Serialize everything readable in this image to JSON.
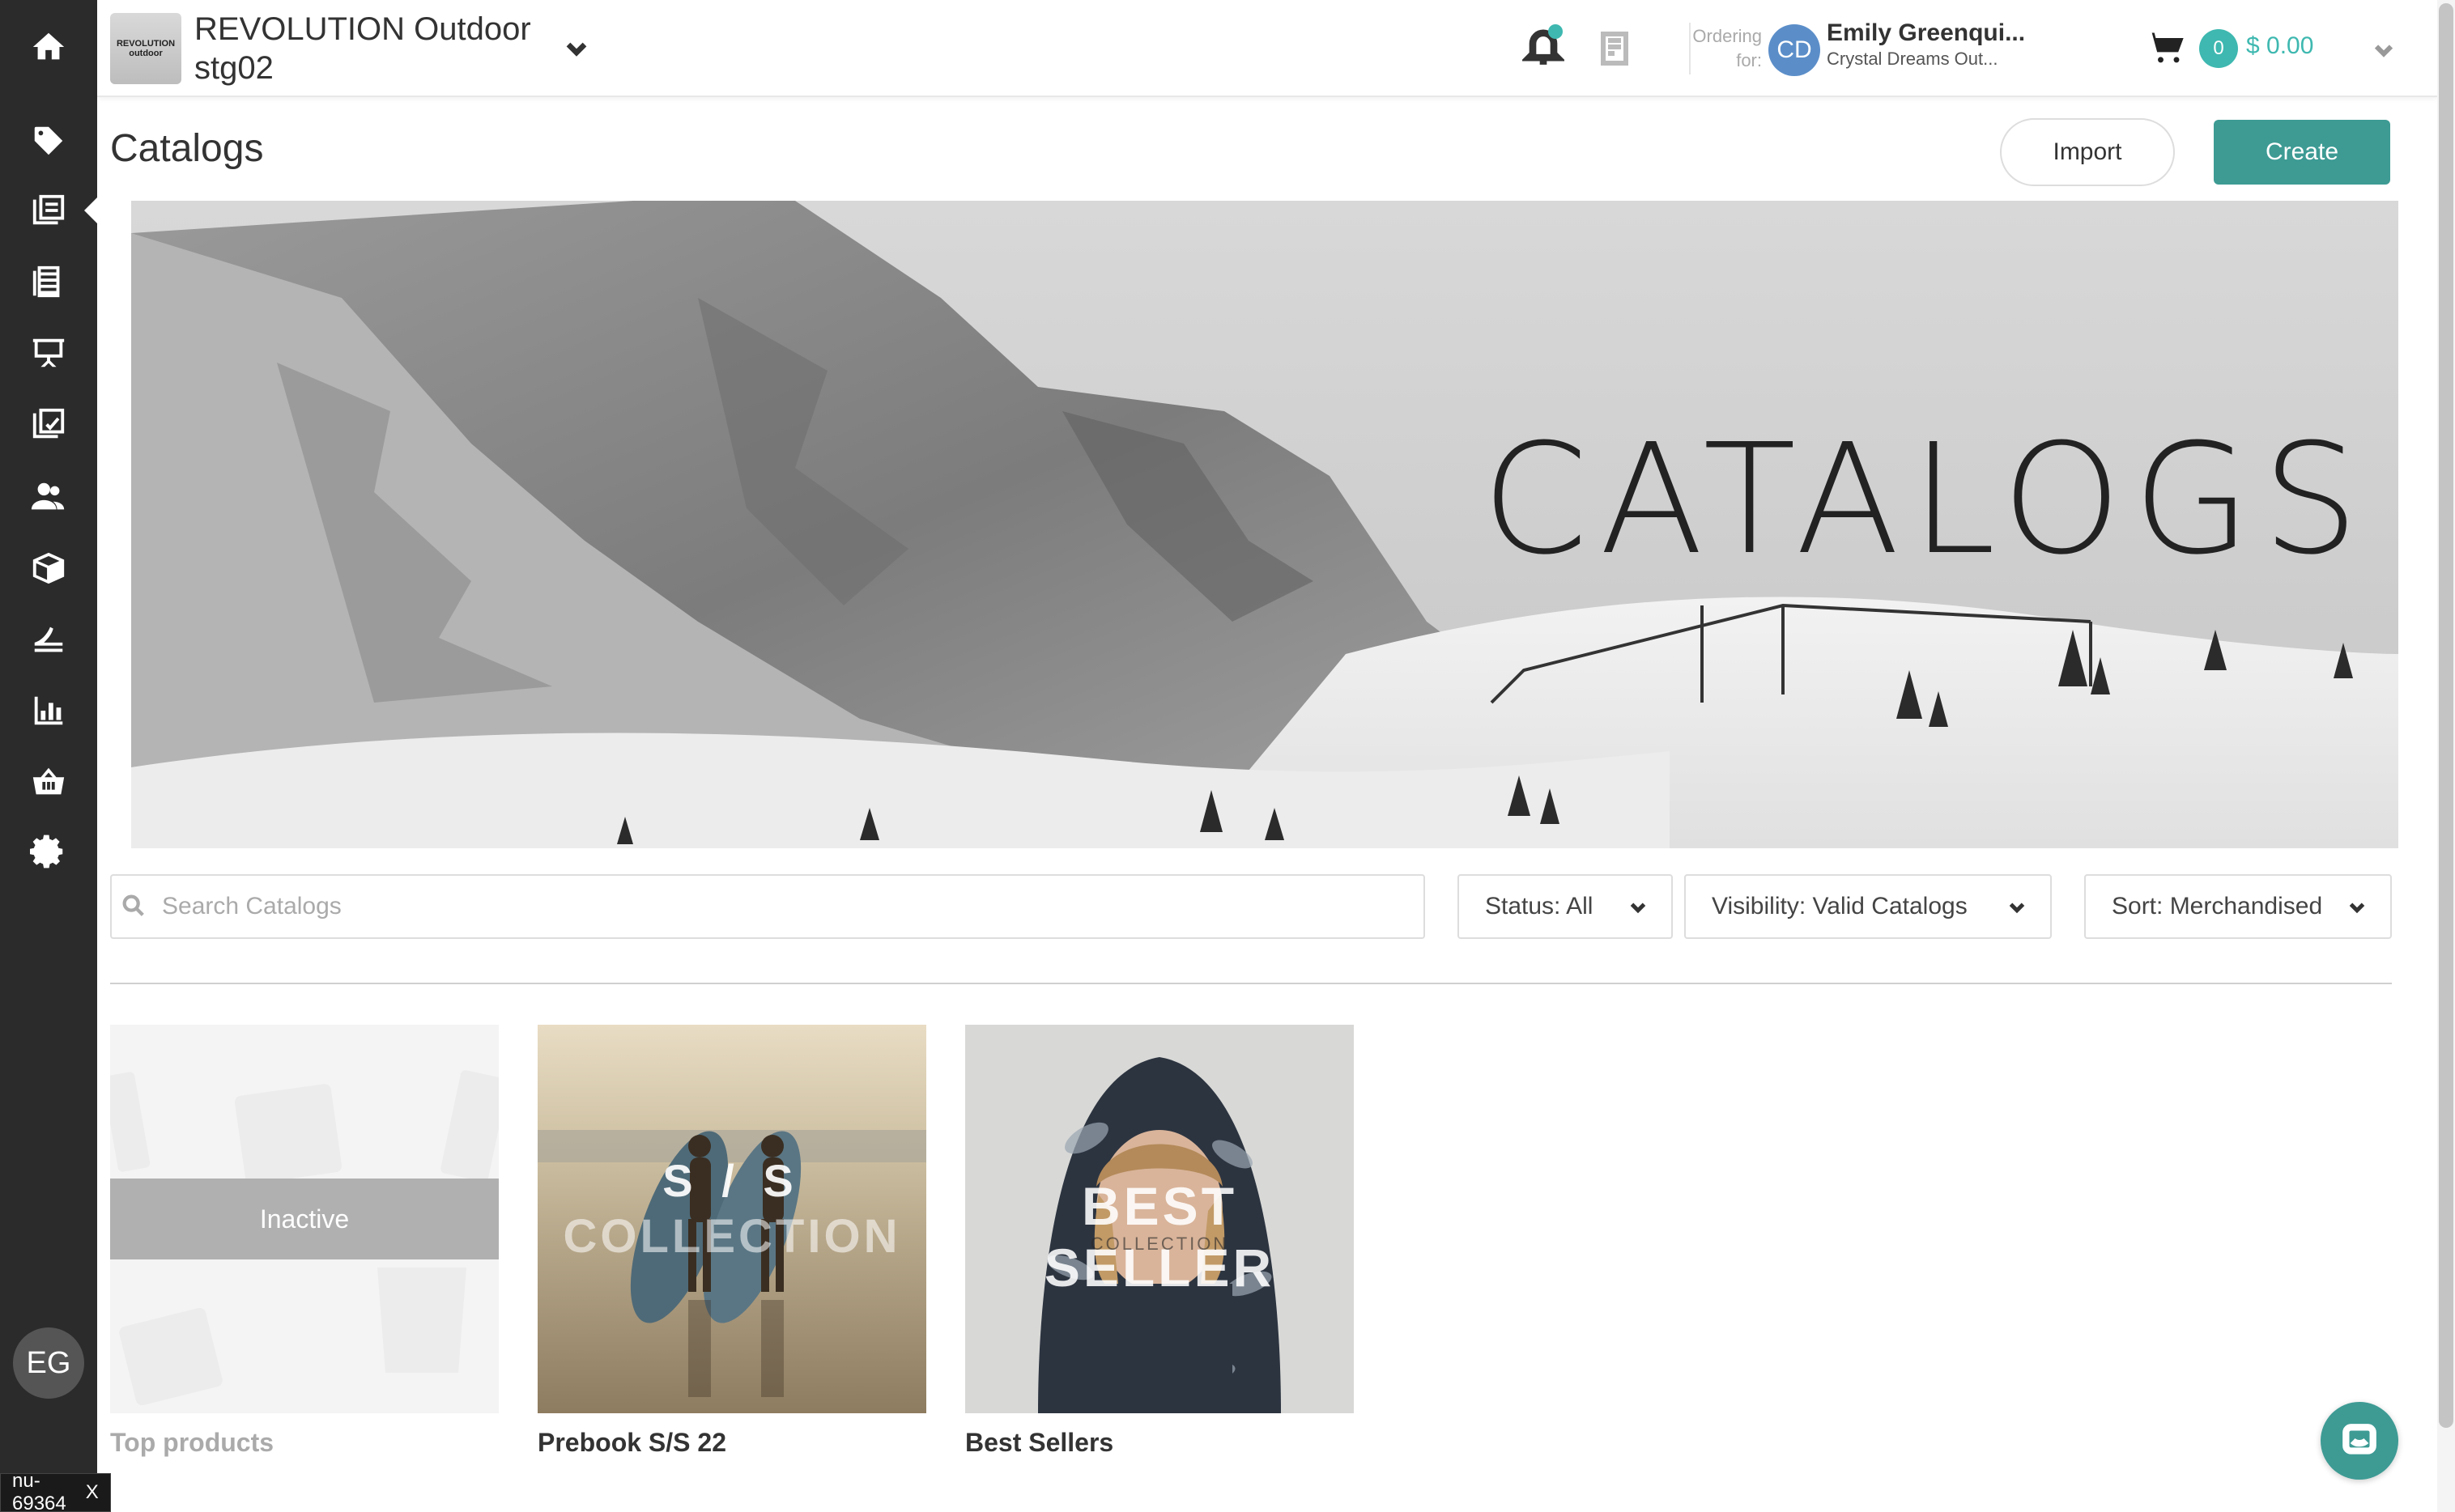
{
  "sidebar": {
    "items": [
      {
        "icon": "home-icon"
      },
      {
        "icon": "tag-icon"
      },
      {
        "icon": "catalogs-icon"
      },
      {
        "icon": "linesheets-icon"
      },
      {
        "icon": "presentation-icon"
      },
      {
        "icon": "orders-checklist-icon"
      },
      {
        "icon": "customers-icon"
      },
      {
        "icon": "products-box-icon"
      },
      {
        "icon": "promotions-icon"
      },
      {
        "icon": "reports-chart-icon"
      },
      {
        "icon": "shop-basket-icon"
      },
      {
        "icon": "settings-gear-icon"
      }
    ],
    "user_initials": "EG",
    "bottom_tag": "nu-69364",
    "bottom_tag_close": "X"
  },
  "header": {
    "logo_line1": "REVOLUTION",
    "logo_line2": "outdoor",
    "brand_line1": "REVOLUTION Outdoor",
    "brand_line2": "stg02",
    "ordering_line1": "Ordering",
    "ordering_line2": "for:",
    "customer_initials": "CD",
    "user_name": "Emily Greenqui...",
    "user_company": "Crystal Dreams Out...",
    "cart_count": "0",
    "cart_total": "$ 0.00",
    "accent_color": "#3eb8b0"
  },
  "page": {
    "title": "Catalogs",
    "import_label": "Import",
    "create_label": "Create",
    "create_color": "#3d9b94",
    "banner_title": "CATALOGS"
  },
  "filters": {
    "search_placeholder": "Search Catalogs",
    "search_value": "",
    "status_label": "Status: All",
    "visibility_label": "Visibility: Valid Catalogs",
    "sort_label": "Sort: Merchandised"
  },
  "catalogs": [
    {
      "title": "Top products",
      "status": "Inactive"
    },
    {
      "title": "Prebook S/S 22",
      "overlay_line1": "S / S",
      "overlay_line2": "COLLECTION"
    },
    {
      "title": "Best Sellers",
      "overlay_line1": "BEST SELLER",
      "overlay_line2": "COLLECTION"
    }
  ]
}
